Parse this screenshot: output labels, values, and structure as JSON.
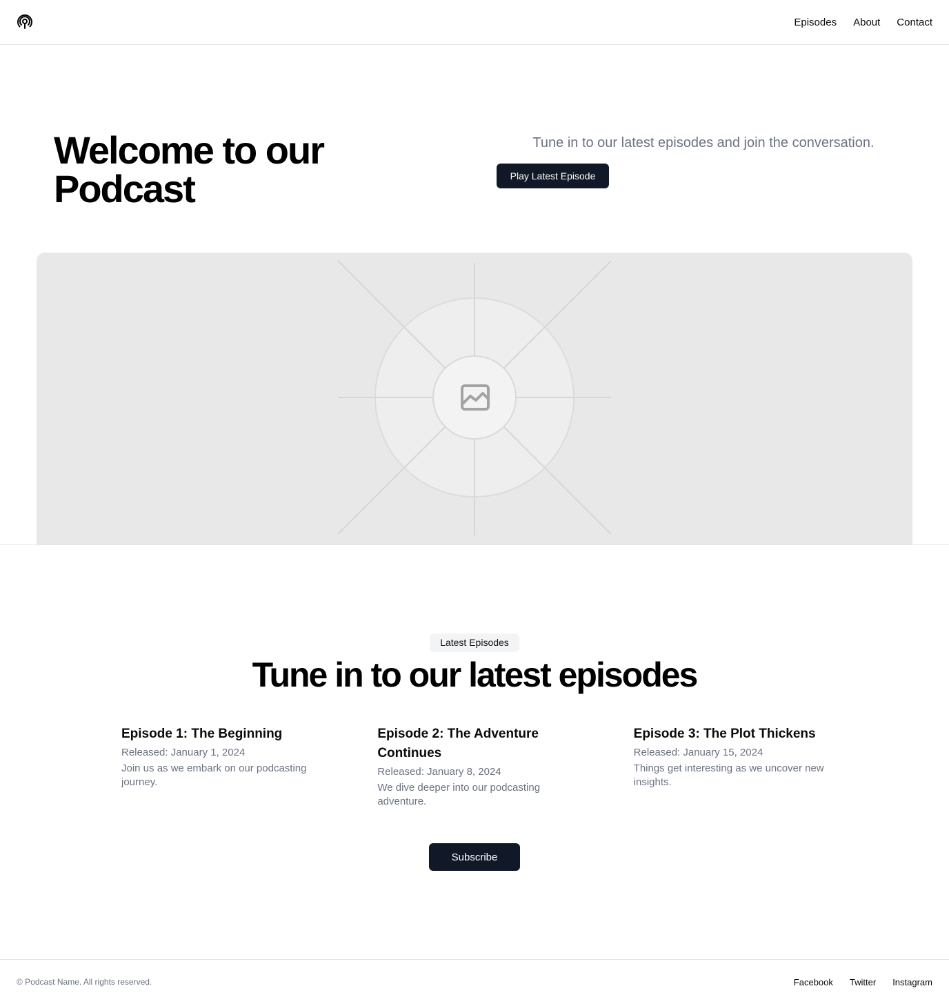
{
  "header": {
    "logo_icon": "podcast-icon",
    "nav": [
      {
        "label": "Episodes"
      },
      {
        "label": "About"
      },
      {
        "label": "Contact"
      }
    ]
  },
  "hero": {
    "title_line1": "Welcome to our",
    "title_line2": "Podcast",
    "subtitle": "Tune in to our latest episodes and join the conversation.",
    "play_button": "Play Latest Episode",
    "image_icon": "image-placeholder-icon"
  },
  "episodes_section": {
    "badge": "Latest Episodes",
    "title": "Tune in to our latest episodes",
    "episodes": [
      {
        "title": "Episode 1: The Beginning",
        "released": "Released: January 1, 2024",
        "description": "Join us as we embark on our podcasting journey."
      },
      {
        "title": "Episode 2: The Adventure Continues",
        "released": "Released: January 8, 2024",
        "description": "We dive deeper into our podcasting adventure."
      },
      {
        "title": "Episode 3: The Plot Thickens",
        "released": "Released: January 15, 2024",
        "description": "Things get interesting as we uncover new insights."
      }
    ],
    "subscribe_button": "Subscribe"
  },
  "footer": {
    "copyright": "© Podcast Name. All rights reserved.",
    "links": [
      {
        "label": "Facebook"
      },
      {
        "label": "Twitter"
      },
      {
        "label": "Instagram"
      }
    ]
  },
  "colors": {
    "primary_button": "#111827",
    "muted_text": "#6b7280",
    "border": "#e5e7eb",
    "placeholder_bg": "#e8e8e8"
  }
}
